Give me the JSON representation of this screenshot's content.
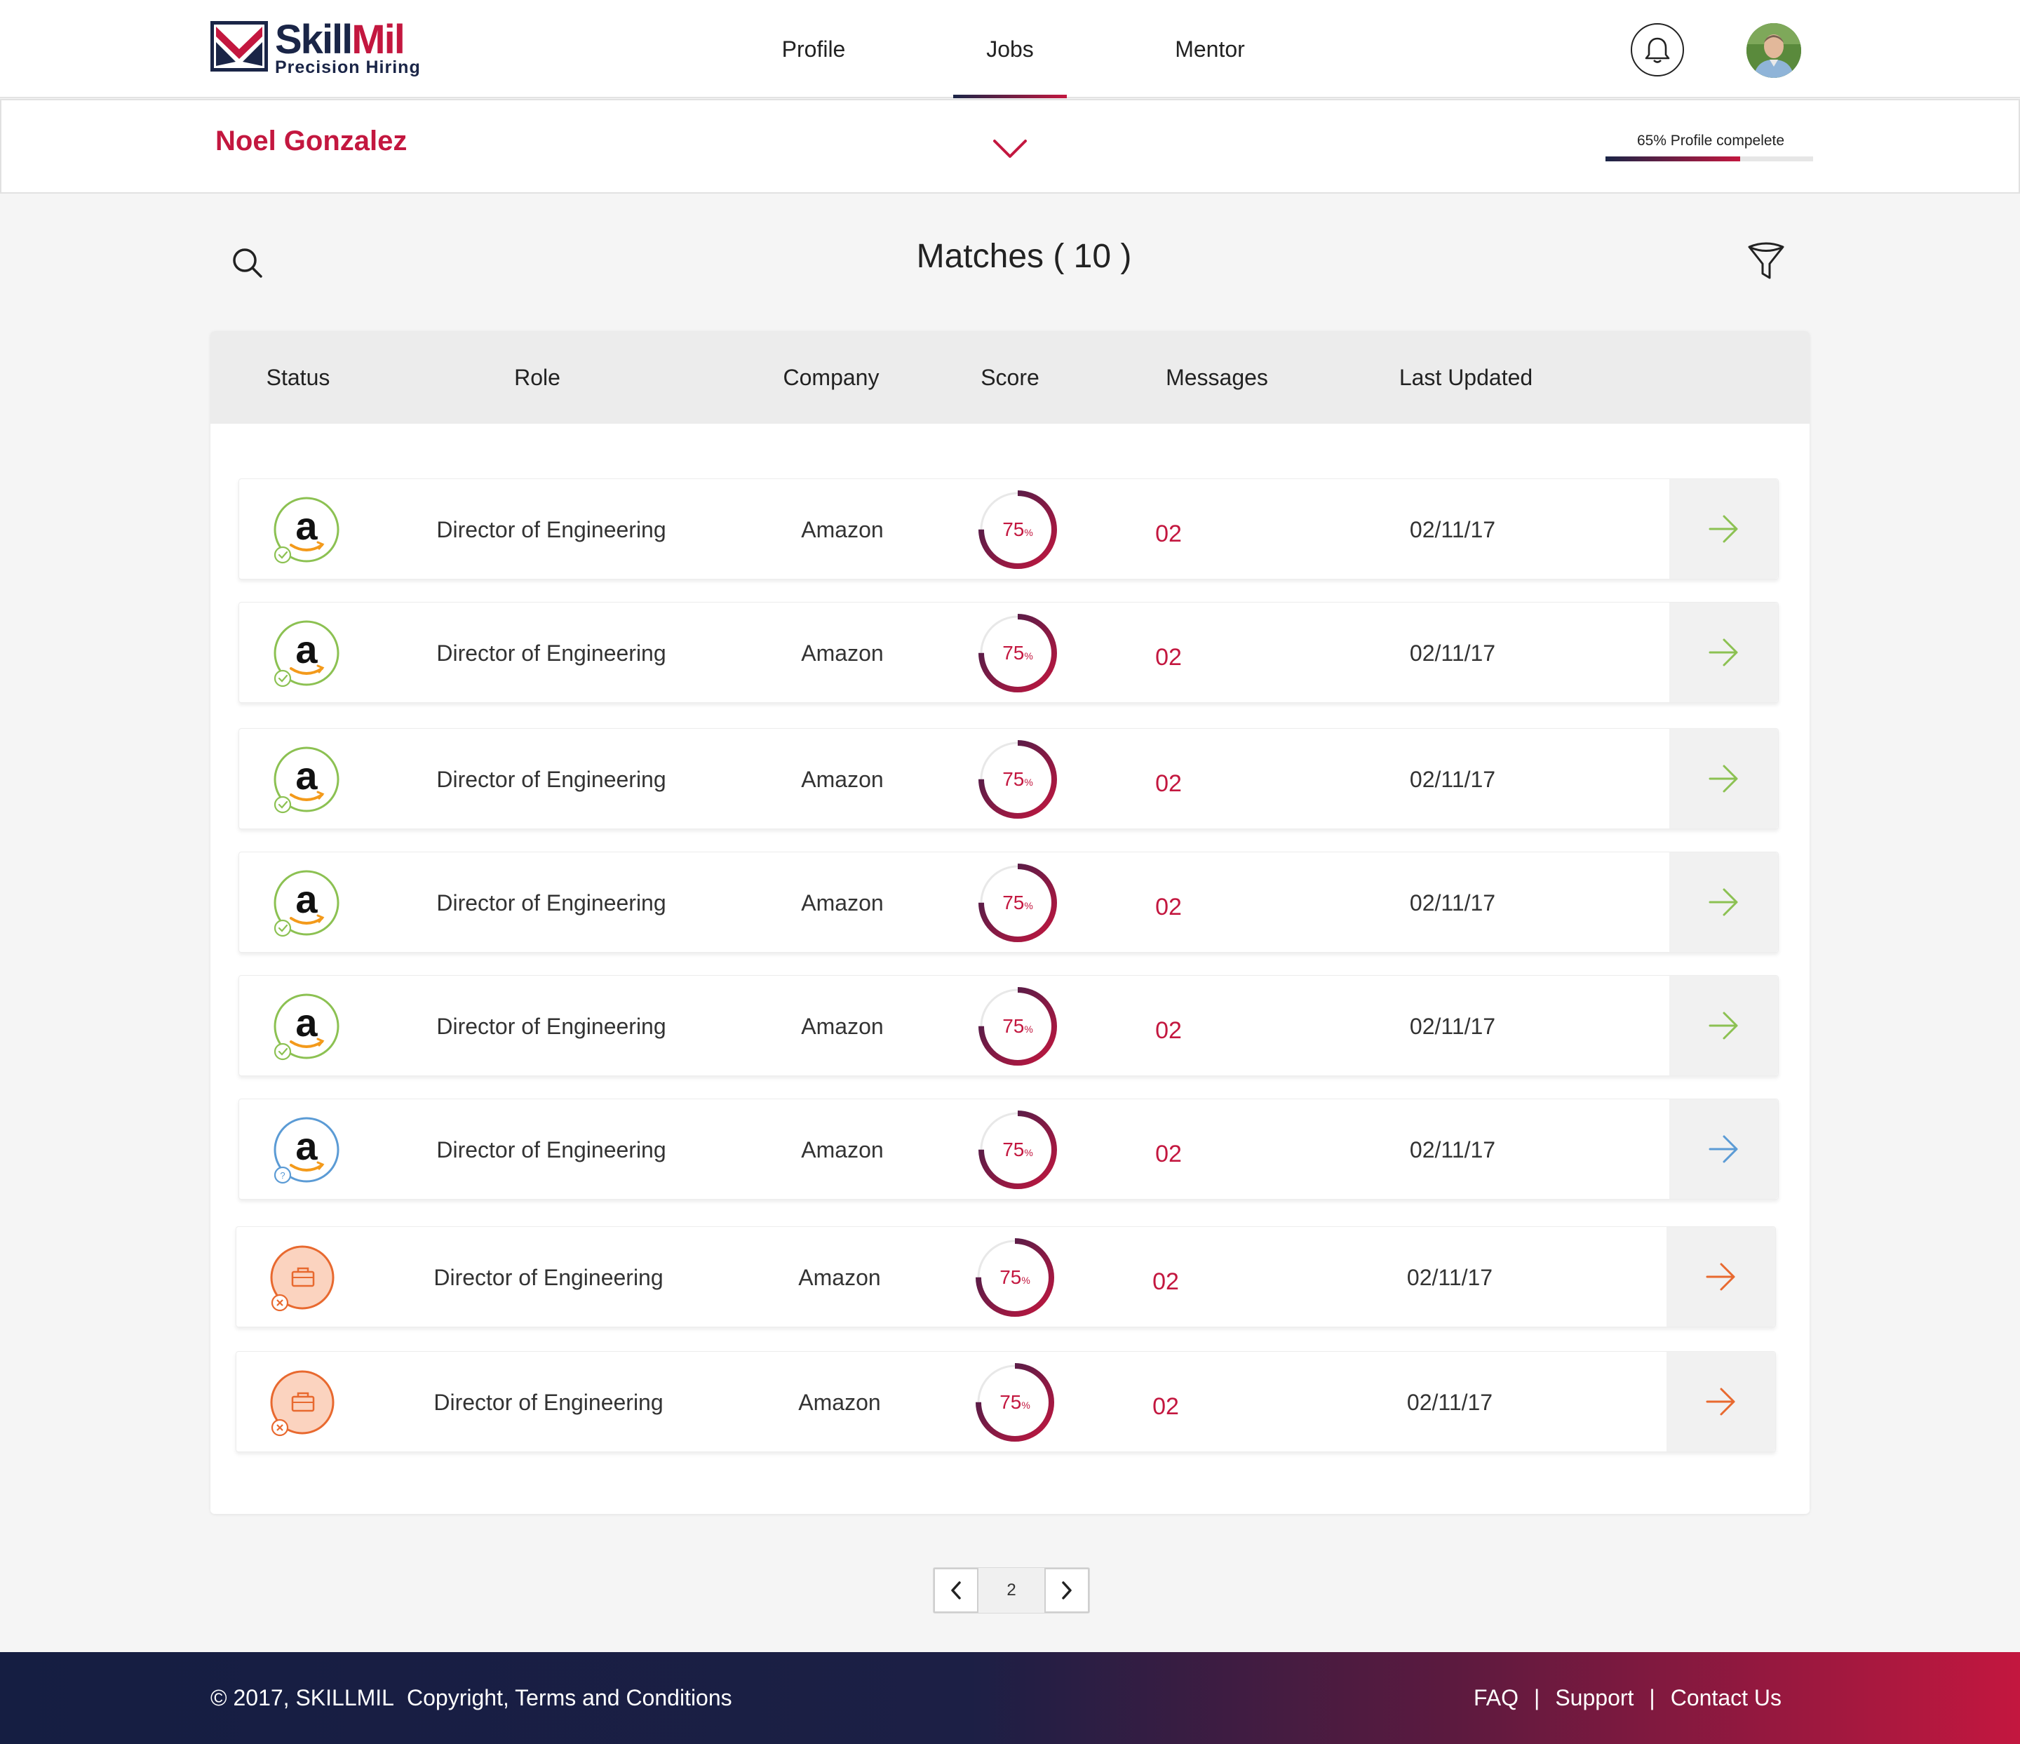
{
  "brand": {
    "name_part1": "Skill",
    "name_part2": "Mil",
    "tagline": "Precision  Hiring",
    "colors": {
      "navy": "#1a2547",
      "crimson": "#c3173f"
    }
  },
  "nav": {
    "items": [
      {
        "label": "Profile",
        "active": false
      },
      {
        "label": "Jobs",
        "active": true
      },
      {
        "label": "Mentor",
        "active": false
      }
    ],
    "notification_icon": "bell-icon",
    "avatar_icon": "user-avatar"
  },
  "profile_strip": {
    "user_name": "Noel Gonzalez",
    "expand_icon": "chevron-down-icon",
    "progress_label": "65% Profile compelete",
    "progress_value": 0.65
  },
  "toolbar": {
    "search_icon": "search-icon",
    "title": "Matches ( 10 )",
    "filter_icon": "filter-funnel-icon"
  },
  "table": {
    "headers": {
      "status": "Status",
      "role": "Role",
      "company": "Company",
      "score": "Score",
      "messages": "Messages",
      "last_updated": "Last Updated"
    },
    "rows": [
      {
        "status": "accepted",
        "role": "Director of Engineering",
        "company": "Amazon",
        "score": "75",
        "score_unit": "%",
        "score_value": 75,
        "messages": "02",
        "last_updated": "02/11/17"
      },
      {
        "status": "accepted",
        "role": "Director of Engineering",
        "company": "Amazon",
        "score": "75",
        "score_unit": "%",
        "score_value": 75,
        "messages": "02",
        "last_updated": "02/11/17"
      },
      {
        "status": "accepted",
        "role": "Director of Engineering",
        "company": "Amazon",
        "score": "75",
        "score_unit": "%",
        "score_value": 75,
        "messages": "02",
        "last_updated": "02/11/17"
      },
      {
        "status": "accepted",
        "role": "Director of Engineering",
        "company": "Amazon",
        "score": "75",
        "score_unit": "%",
        "score_value": 75,
        "messages": "02",
        "last_updated": "02/11/17"
      },
      {
        "status": "accepted",
        "role": "Director of Engineering",
        "company": "Amazon",
        "score": "75",
        "score_unit": "%",
        "score_value": 75,
        "messages": "02",
        "last_updated": "02/11/17"
      },
      {
        "status": "pending",
        "role": "Director of Engineering",
        "company": "Amazon",
        "score": "75",
        "score_unit": "%",
        "score_value": 75,
        "messages": "02",
        "last_updated": "02/11/17"
      },
      {
        "status": "rejected",
        "role": "Director of Engineering",
        "company": "Amazon",
        "score": "75",
        "score_unit": "%",
        "score_value": 75,
        "messages": "02",
        "last_updated": "02/11/17"
      },
      {
        "status": "rejected",
        "role": "Director of Engineering",
        "company": "Amazon",
        "score": "75",
        "score_unit": "%",
        "score_value": 75,
        "messages": "02",
        "last_updated": "02/11/17"
      }
    ],
    "status_colors": {
      "accepted": "#8cc152",
      "pending": "#5b9bd5",
      "rejected": "#e8692f"
    },
    "row_action_icon": "arrow-right-icon"
  },
  "pagination": {
    "current_page": "2",
    "prev_icon": "chevron-left-icon",
    "next_icon": "chevron-right-icon"
  },
  "footer": {
    "copyright": "© 2017, SKILLMIL",
    "terms": "Copyright, Terms and Conditions",
    "links": [
      "FAQ",
      "Support",
      "Contact Us"
    ],
    "separator": "|"
  }
}
